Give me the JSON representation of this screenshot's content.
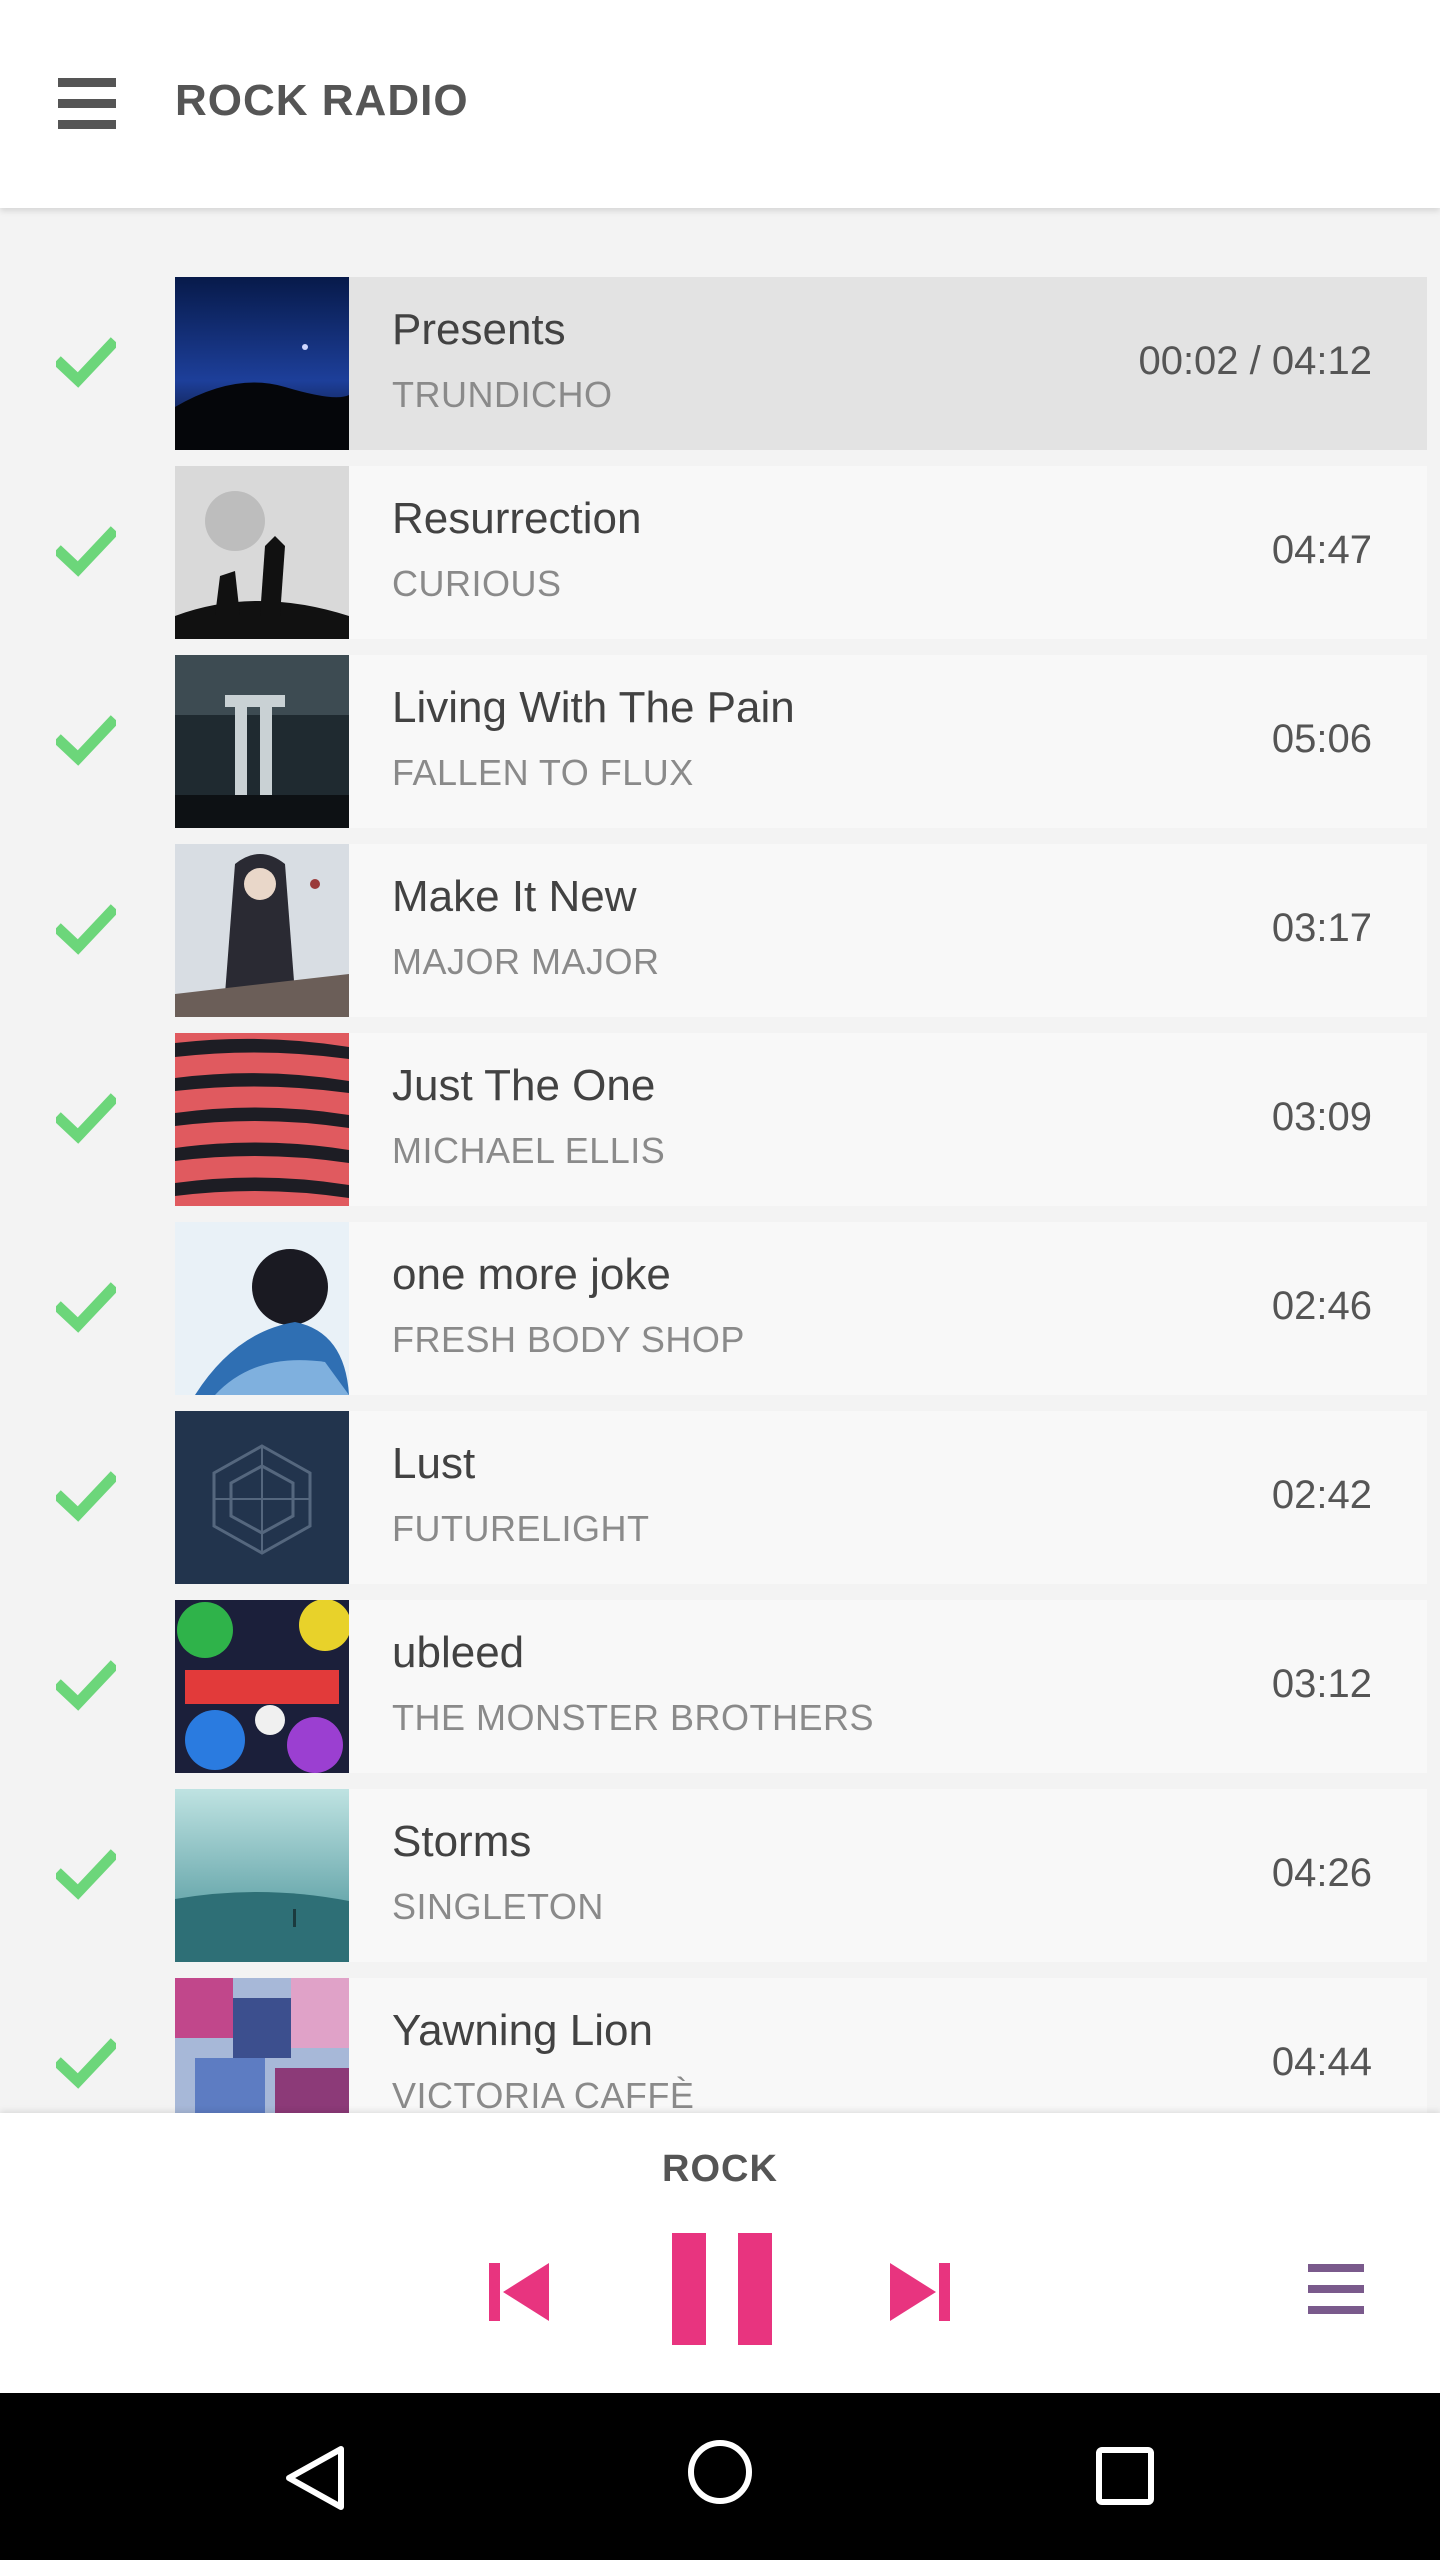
{
  "app": {
    "title": "ROCK RADIO",
    "accent": "#e8347f",
    "check_color": "#6cd67a"
  },
  "tracks": [
    {
      "title": "Presents",
      "artist": "TRUNDICHO",
      "duration": "00:02 / 04:12",
      "active": true,
      "played": true
    },
    {
      "title": "Resurrection",
      "artist": "CURIOUS",
      "duration": "04:47",
      "played": true
    },
    {
      "title": "Living With The Pain",
      "artist": "FALLEN TO FLUX",
      "duration": "05:06",
      "played": true
    },
    {
      "title": "Make It New",
      "artist": "MAJOR MAJOR",
      "duration": "03:17",
      "played": true
    },
    {
      "title": "Just The One",
      "artist": "MICHAEL ELLIS",
      "duration": "03:09",
      "played": true
    },
    {
      "title": "one more joke",
      "artist": "FRESH BODY SHOP",
      "duration": "02:46",
      "played": true
    },
    {
      "title": "Lust",
      "artist": "FUTURELIGHT",
      "duration": "02:42",
      "played": true
    },
    {
      "title": "ubleed",
      "artist": "THE MONSTER BROTHERS",
      "duration": "03:12",
      "played": true
    },
    {
      "title": "Storms",
      "artist": "SINGLETON",
      "duration": "04:26",
      "played": true
    },
    {
      "title": "Yawning Lion",
      "artist": "VICTORIA CAFFÈ",
      "duration": "04:44",
      "played": true
    }
  ],
  "player": {
    "station": "ROCK",
    "icons": [
      "skip-previous-icon",
      "pause-icon",
      "skip-next-icon",
      "queue-icon"
    ]
  },
  "navbar": {
    "icons": [
      "back-icon",
      "home-icon",
      "recents-icon"
    ]
  }
}
